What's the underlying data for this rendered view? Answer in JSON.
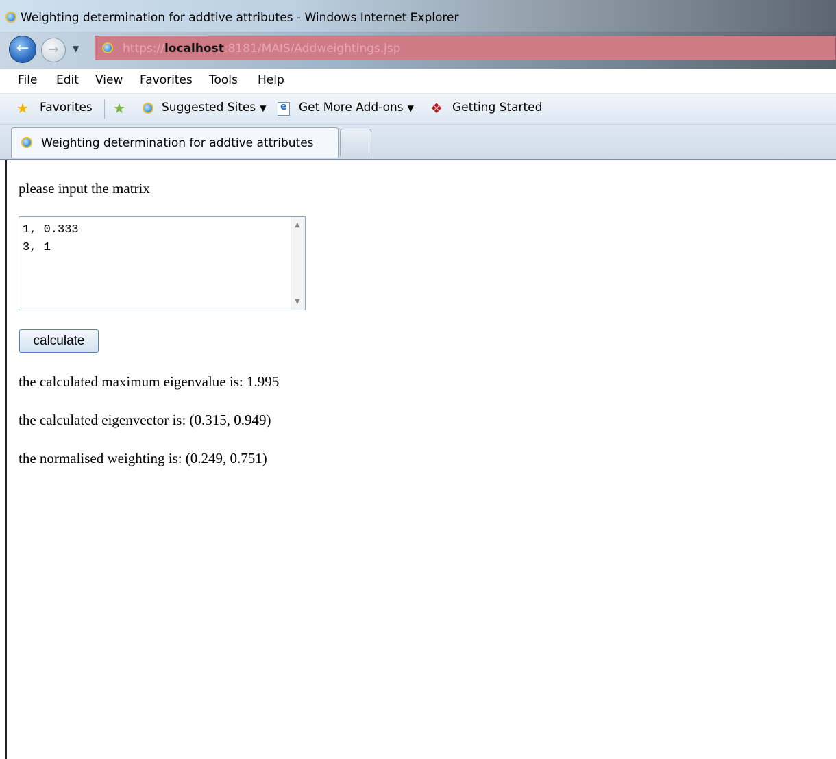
{
  "window": {
    "title": "Weighting determination for addtive attributes - Windows Internet Explorer"
  },
  "address_bar": {
    "url_prefix": "https://",
    "url_host": "localhost",
    "url_rest": ":8181/MAIS/Addweightings.jsp"
  },
  "menu": {
    "items": [
      "File",
      "Edit",
      "View",
      "Favorites",
      "Tools",
      "Help"
    ]
  },
  "favorites_bar": {
    "favorites_label": "Favorites",
    "suggested_sites": "Suggested Sites",
    "get_more_addons": "Get More Add-ons",
    "getting_started": "Getting Started"
  },
  "tab": {
    "title": "Weighting determination for addtive attributes"
  },
  "page": {
    "prompt": "please input the matrix",
    "matrix_value": "1, 0.333\n3, 1",
    "calculate_label": "calculate",
    "max_eigenvalue_text": "the calculated maximum eigenvalue is: 1.995",
    "eigenvector_text": "the calculated eigenvector is: (0.315, 0.949)",
    "normalised_text": "the normalised weighting is: (0.249, 0.751)"
  }
}
